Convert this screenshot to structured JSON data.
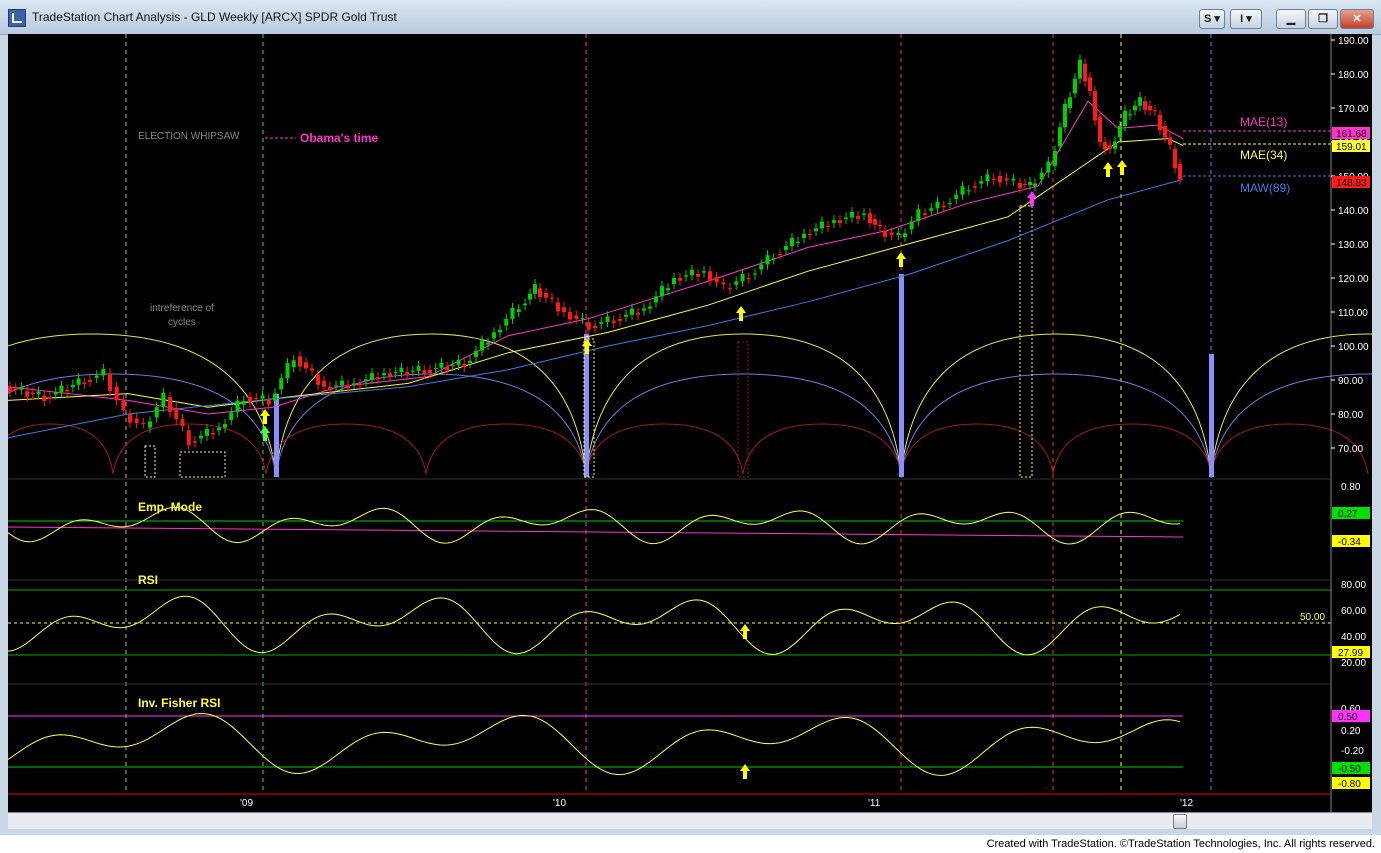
{
  "window": {
    "title": "TradeStation Chart Analysis - GLD Weekly [ARCX] SPDR Gold Trust",
    "buttons": {
      "s_label": "S",
      "i_label": "I"
    }
  },
  "colors": {
    "background": "#000000",
    "price_axis": "#ffffff",
    "up_candle": "#00d000",
    "down_candle": "#ff1a1a",
    "mae13": "#ff33cc",
    "mae34": "#ffff33",
    "maw89": "#3a7ee8",
    "cycle_yellow": "#e6e64c",
    "cycle_blue": "#6f7ae0",
    "cycle_red": "#a01818",
    "arrow_yellow": "#ffff00",
    "arrow_magenta": "#ff33ff"
  },
  "price_panel": {
    "axis_ticks": [
      "190.00",
      "180.00",
      "170.00",
      "160.00",
      "150.00",
      "140.00",
      "130.00",
      "120.00",
      "110.00",
      "100.00",
      "90.00",
      "80.00",
      "70.00"
    ],
    "labels": {
      "mae13": "MAE(13)",
      "mae34": "MAE(34)",
      "maw89": "MAW(89)",
      "election": "ELECTION WHIPSAW",
      "obama": "Obama's time",
      "interference_1": "intreference of",
      "interference_2": "cycles"
    },
    "value_badges": {
      "mae13": "161.68",
      "mae34": "159.01",
      "last": "148.83"
    }
  },
  "emd_panel": {
    "label": "Emp. Mode",
    "axis_ticks": [
      "0.80"
    ],
    "badges": {
      "upper": "0.27",
      "lower": "-0.34"
    }
  },
  "rsi_panel": {
    "label": "RSI",
    "axis_ticks": [
      "80.00",
      "60.00",
      "40.00",
      "20.00"
    ],
    "mid_label": "50.00",
    "badge": "27.99"
  },
  "fisher_panel": {
    "label": "Inv. Fisher RSI",
    "axis_ticks": [
      "0.60",
      "0.20",
      "-0.20"
    ],
    "badges": {
      "upper": "0.50",
      "lower": "-0.50",
      "last": "-0.80"
    }
  },
  "time_axis": {
    "ticks": [
      "'09",
      "'10",
      "'11",
      "'12"
    ]
  },
  "footer": {
    "copyright": "Created with TradeStation. ©TradeStation Technologies, Inc. All rights reserved."
  }
}
